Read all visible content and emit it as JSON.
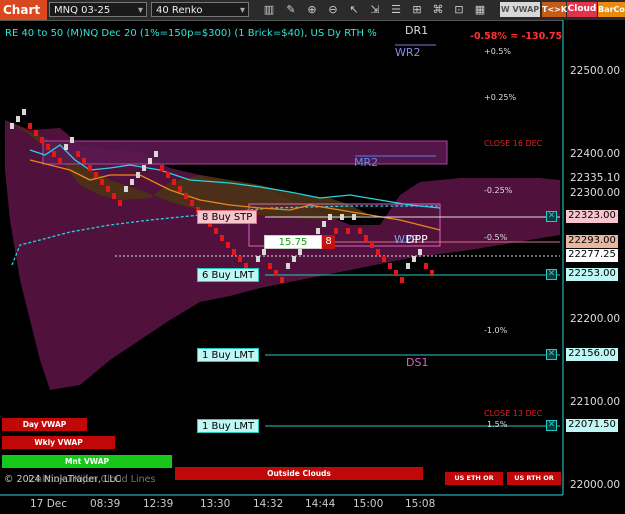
{
  "toolbar": {
    "chart_label": "Chart",
    "instrument": "MNQ 03-25",
    "bar_type": "40 Renko",
    "vwap_label": "W VWAP",
    "tck_label": "T<>K",
    "cloud_label": "Cloud",
    "barco_label": "BarCo",
    "icons": [
      "bars-icon",
      "pencil-icon",
      "zoom-in-icon",
      "zoom-out-icon",
      "cursor-icon",
      "scroll-icon",
      "data-box-icon",
      "properties-icon",
      "strategy-icon",
      "indicators-icon",
      "layout-icon",
      "share-icon",
      "chart-trader-icon"
    ]
  },
  "chart": {
    "title": "RE 40 to 50 (M)NQ Dec 20 (1%=150p=$300) (1 Brick=$40), US Dy RTH %",
    "pnl": "-0.58% = -130.75",
    "watermark": "© 2024 NinjaTrader, LLC",
    "indicator_note": "Ichimoku Kijun Cloud Lines",
    "price_axis": [
      "22500.00",
      "22400.00",
      "22335.10",
      "22300.00",
      "22200.00",
      "22100.00",
      "22000.00"
    ],
    "time_axis": [
      "17 Dec",
      "08:39",
      "12:39",
      "13:30",
      "14:32",
      "14:44",
      "15:00",
      "15:08"
    ],
    "pivots": {
      "dr1": "DR1",
      "wr2": "WR2",
      "mr2": "MR2",
      "dpp": "DPP",
      "wpp": "WPP",
      "ds1": "DS1"
    },
    "percent_levels": [
      "+0.5%",
      "+0.25%",
      "-0.25%",
      "-0.5%",
      "-1.0%",
      "1.5%"
    ],
    "close_labels": [
      "CLOSE 16 DEC",
      "CLOSE 13 DEC"
    ],
    "price_tags": {
      "stop_price": "22323.00",
      "target_price": "22293.00",
      "last_price": "22277.25",
      "limit1_price": "22253.00",
      "limit2_price": "22156.00",
      "limit3_price": "22071.50"
    },
    "orders": {
      "stop_label": "8 Buy STP",
      "position_pnl": "15.75",
      "position_qty": "8",
      "limit1_label": "6 Buy LMT",
      "limit2_label": "1 Buy LMT",
      "limit3_label": "1 Buy LMT"
    },
    "indicators": {
      "day_vwap": "Day VWAP",
      "wkly_vwap": "Wkly VWAP",
      "mnt_vwap": "Mnt VWAP",
      "outside_clouds": "Outside Clouds",
      "us_eth_or": "US ETH OR",
      "us_rth_or": "US RTH OR"
    },
    "colors": {
      "bull_brick": "#d8d8d8",
      "bear_brick": "#e01818",
      "kijun": "#25d4e0",
      "tenkan": "#e8881a",
      "cloud_bear": "#8a1d5a",
      "cloud_bull": "#6b4a1f",
      "order_line": "#25c9c0",
      "accent_red": "#cc1111"
    }
  },
  "chart_data": {
    "type": "renko",
    "instrument": "MNQ 03-25",
    "bar_type": "40 Renko",
    "x": [
      "17 Dec",
      "08:39",
      "12:39",
      "13:30",
      "14:32",
      "14:44",
      "15:00",
      "15:08"
    ],
    "y_ticks": [
      22500.0,
      22400.0,
      22300.0,
      22200.0,
      22100.0,
      22000.0
    ],
    "ylim": [
      21975,
      22560
    ],
    "last_price": 22277.25,
    "labeled_prices": [
      22335.1,
      22323.0,
      22293.0,
      22277.25,
      22253.0,
      22156.0,
      22071.5
    ],
    "bricks": {
      "directions": [
        "u",
        "u",
        "u",
        "d",
        "d",
        "d",
        "d",
        "d",
        "d",
        "u",
        "u",
        "d",
        "d",
        "d",
        "d",
        "d",
        "d",
        "d",
        "d",
        "u",
        "u",
        "u",
        "u",
        "u",
        "u",
        "d",
        "d",
        "d",
        "d",
        "d",
        "d",
        "d",
        "d",
        "d",
        "d",
        "d",
        "d",
        "d",
        "d",
        "d",
        "d",
        "u",
        "u",
        "d",
        "d",
        "d",
        "u",
        "u",
        "u",
        "u",
        "u",
        "u",
        "u",
        "u",
        "d",
        "u",
        "d",
        "u",
        "d",
        "d",
        "d",
        "d",
        "d",
        "d",
        "d",
        "d",
        "u",
        "u",
        "u",
        "d",
        "d"
      ],
      "brick_size": 10
    }
  }
}
